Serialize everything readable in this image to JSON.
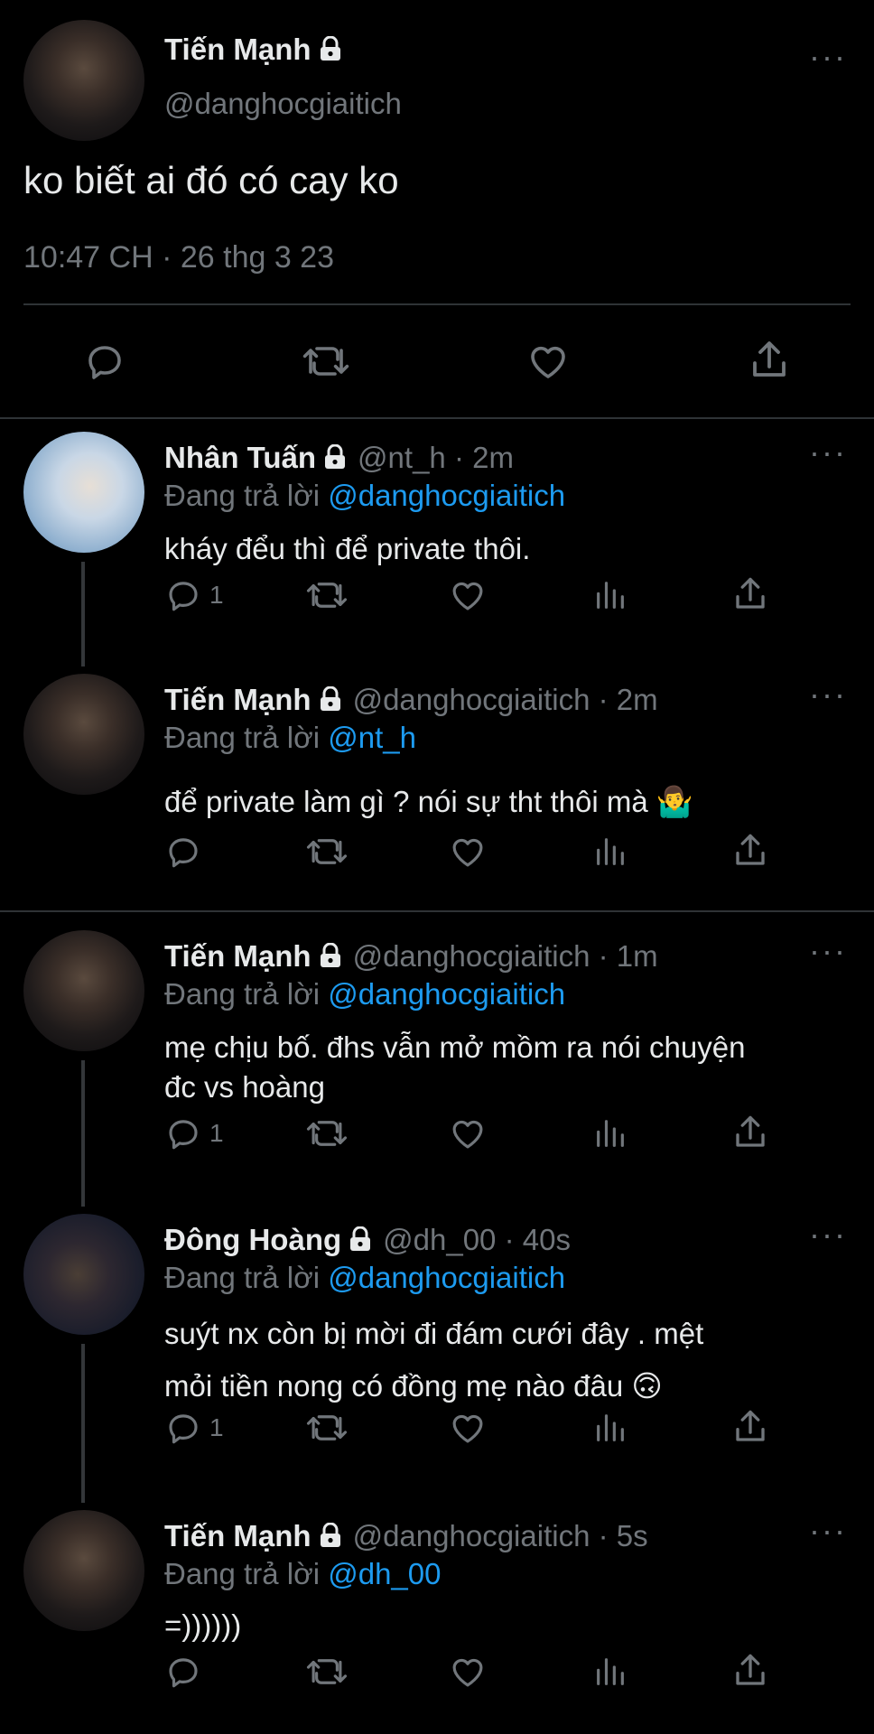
{
  "main_tweet": {
    "name": "Tiến Mạnh",
    "handle": "@danghocgiaitich",
    "text": "ko biết ai đó có cay ko",
    "time": "10:47 CH · 26 thg 3 23"
  },
  "replying_prefix": "Đang trả lời",
  "more_label": "···",
  "replies": [
    {
      "name": "Nhân Tuấn",
      "meta": "@nt_h · 2m",
      "replying_to": "@danghocgiaitich",
      "lines": [
        "kháy đểu thì để private thôi."
      ],
      "reply_count": "1",
      "emoji": ""
    },
    {
      "name": "Tiến Mạnh",
      "meta": "@danghocgiaitich · 2m",
      "replying_to": "@nt_h",
      "lines": [
        "để private làm gì ? nói sự tht thôi mà"
      ],
      "reply_count": "",
      "emoji": "🤷‍♂️"
    },
    {
      "name": "Tiến Mạnh",
      "meta": "@danghocgiaitich · 1m",
      "replying_to": "@danghocgiaitich",
      "lines": [
        "mẹ chịu bố. đhs vẫn mở mồm ra nói chuyện",
        "đc vs hoàng"
      ],
      "reply_count": "1",
      "emoji": ""
    },
    {
      "name": "Đông Hoàng",
      "meta": "@dh_00 · 40s",
      "replying_to": "@danghocgiaitich",
      "lines": [
        "suýt nx còn bị mời đi đám cưới đây . mệt",
        "mỏi tiền nong có đồng mẹ nào đâu"
      ],
      "reply_count": "1",
      "emoji": "🙃"
    },
    {
      "name": "Tiến Mạnh",
      "meta": "@danghocgiaitich · 5s",
      "replying_to": "@dh_00",
      "lines": [
        "=))))))"
      ],
      "reply_count": "",
      "emoji": ""
    }
  ],
  "colors": {
    "background": "#000000",
    "text": "#e7e9ea",
    "muted": "#71767b",
    "link": "#1d9bf0",
    "divider": "#2f3336"
  },
  "icons": [
    "lock-icon",
    "more-icon",
    "reply-icon",
    "retweet-icon",
    "like-icon",
    "views-icon",
    "share-icon"
  ]
}
